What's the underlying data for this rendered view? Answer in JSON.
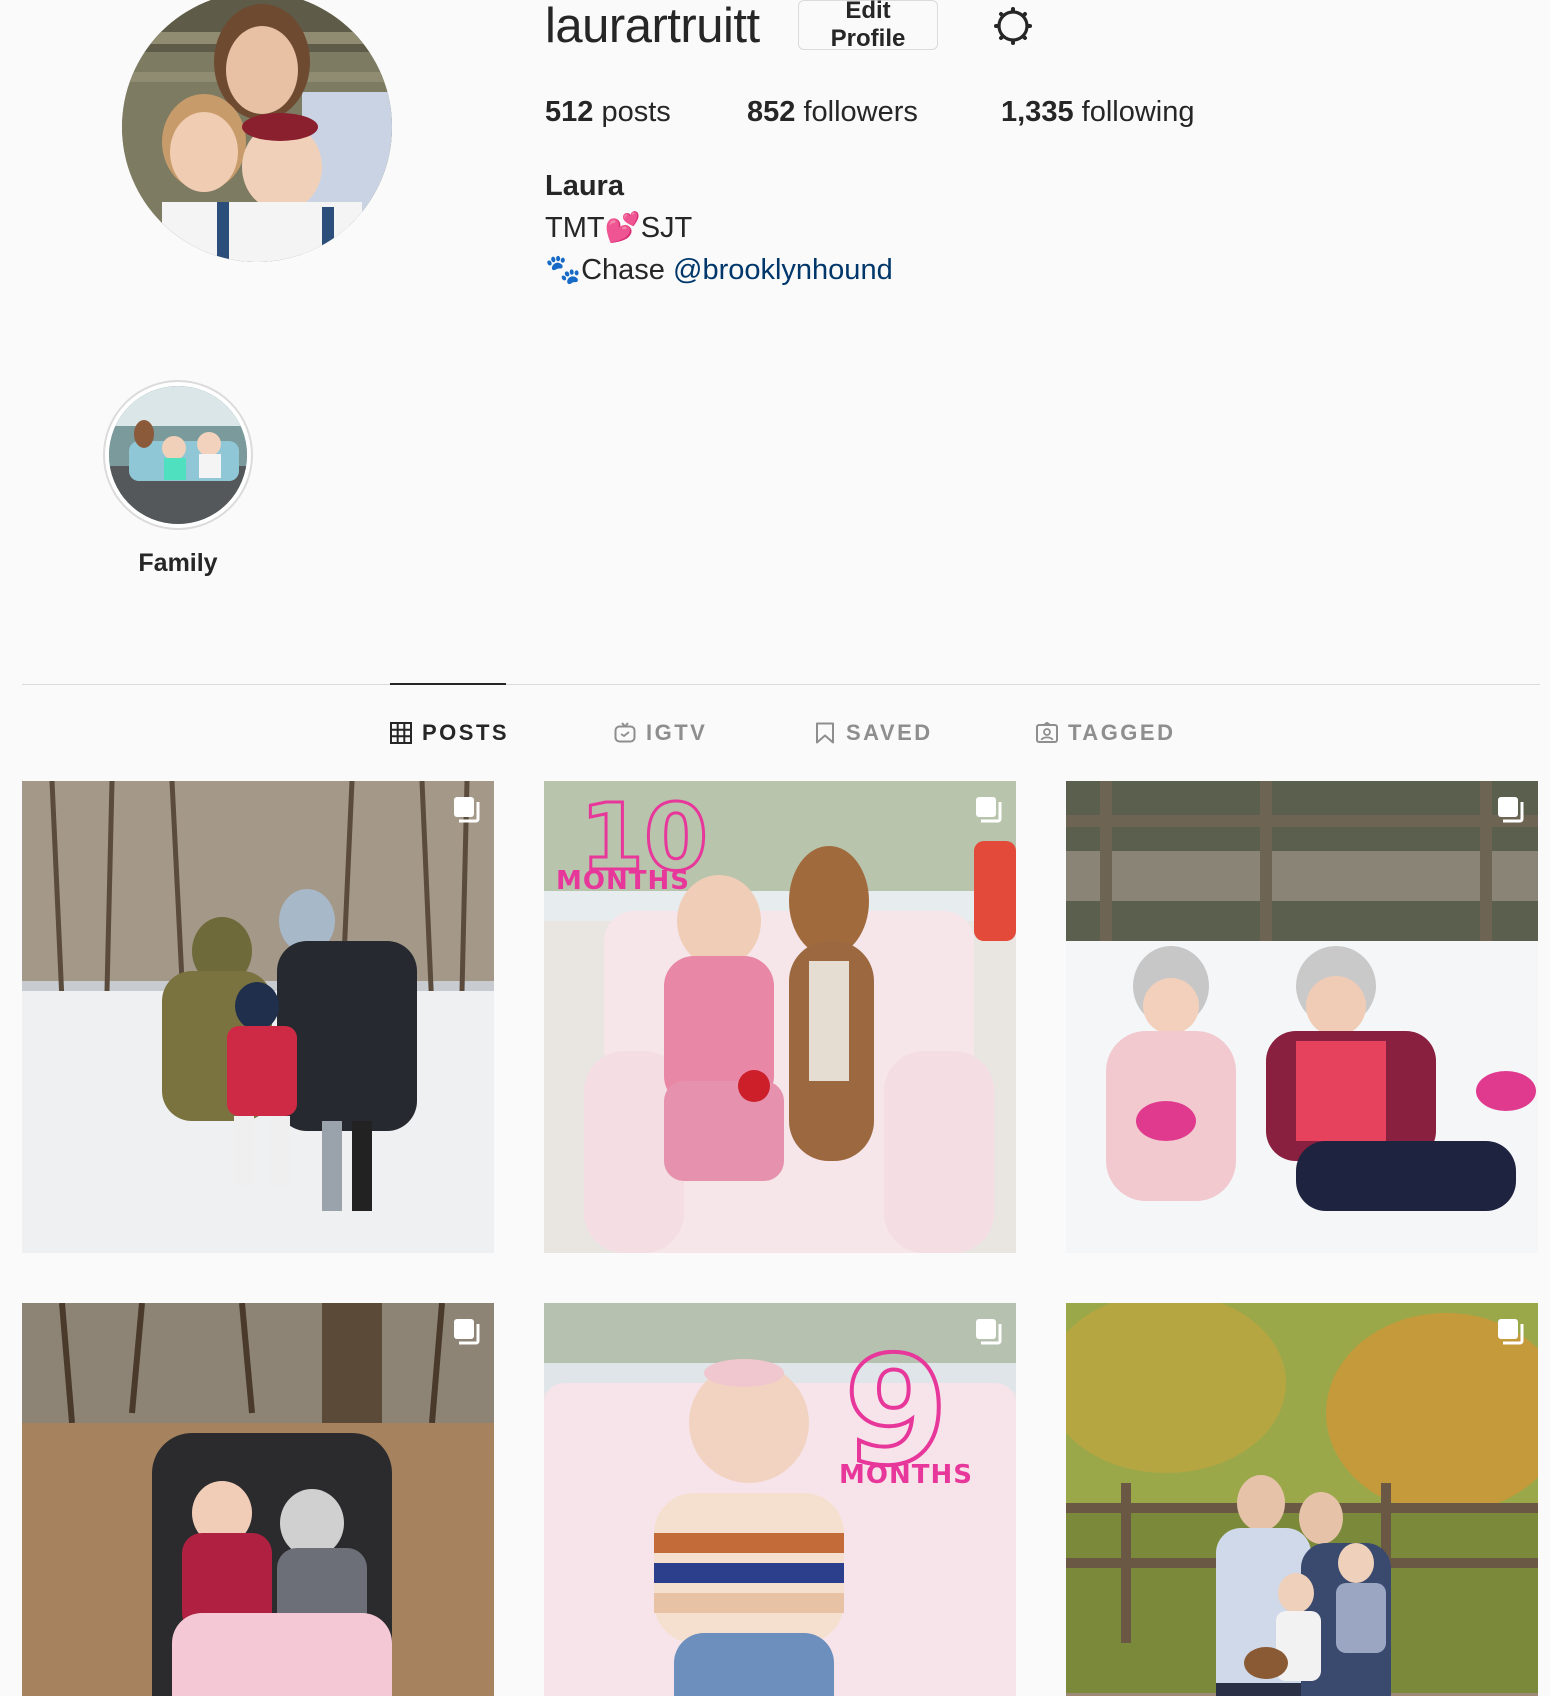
{
  "profile": {
    "username": "laurartruitt",
    "edit_profile_label": "Edit Profile",
    "stats": {
      "posts_count": "512",
      "posts_label": " posts",
      "followers_count": "852",
      "followers_label": " followers",
      "following_count": "1,335",
      "following_label": " following"
    },
    "full_name": "Laura",
    "bio": {
      "line1_a": "TMT",
      "line1_heart": "💕",
      "line1_b": "SJT",
      "line2_paw": "🐾",
      "line2_text": "Chase ",
      "line2_mention": "@brooklynhound"
    }
  },
  "highlights": [
    {
      "label": "Family"
    }
  ],
  "tabs": [
    {
      "label": "POSTS",
      "icon": "grid-icon",
      "active": true
    },
    {
      "label": "IGTV",
      "icon": "igtv-icon",
      "active": false
    },
    {
      "label": "SAVED",
      "icon": "bookmark-icon",
      "active": false
    },
    {
      "label": "TAGGED",
      "icon": "tagged-icon",
      "active": false
    }
  ],
  "posts": [
    {
      "icon": "multiple-photos-icon",
      "overlay_text": ""
    },
    {
      "icon": "multiple-photos-icon",
      "overlay_text": "10",
      "overlay_subtext": "MONTHS"
    },
    {
      "icon": "multiple-photos-icon",
      "overlay_text": ""
    },
    {
      "icon": "multiple-photos-icon",
      "overlay_text": ""
    },
    {
      "icon": "multiple-photos-icon",
      "overlay_text": "9",
      "overlay_subtext": "MONTHS"
    },
    {
      "icon": "multiple-photos-icon",
      "overlay_text": ""
    }
  ],
  "colors": {
    "background": "#fafafa",
    "text": "#262626",
    "muted": "#8e8e8e",
    "border": "#dbdbdb",
    "link": "#00376b",
    "overlay_pink": "#e8379b"
  }
}
